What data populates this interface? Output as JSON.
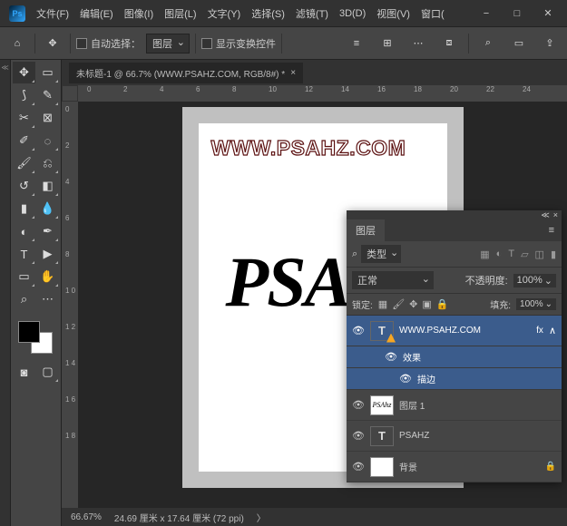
{
  "menu": {
    "file": "文件(F)",
    "edit": "编辑(E)",
    "image": "图像(I)",
    "layer": "图层(L)",
    "type": "文字(Y)",
    "select": "选择(S)",
    "filter": "滤镜(T)",
    "threeD": "3D(D)",
    "view": "视图(V)",
    "window": "窗口(",
    "win_min": "−",
    "win_max": "□",
    "win_close": "✕"
  },
  "opt": {
    "auto_select": "自动选择：",
    "target": "图层",
    "show_transform": "显示变换控件"
  },
  "doc": {
    "tab": "未标题-1 @ 66.7% (WWW.PSAHZ.COM, RGB/8#) *",
    "close": "×"
  },
  "ruler_h": {
    "r0": "0",
    "r2": "2",
    "r4": "4",
    "r6": "6",
    "r8": "8",
    "r10": "10",
    "r12": "12",
    "r14": "14",
    "r16": "16",
    "r18": "18",
    "r20": "20",
    "r22": "22",
    "r24": "24"
  },
  "ruler_v": {
    "r0": "0",
    "r2": "2",
    "r4": "4",
    "r6": "6",
    "r8": "8",
    "r10": "1\n0",
    "r12": "1\n2",
    "r14": "1\n4",
    "r16": "1\n6",
    "r18": "1\n8"
  },
  "canvas": {
    "watermark": "WWW.PSAHZ.COM",
    "script": "PSAH"
  },
  "status": {
    "zoom": "66.67%",
    "dims": "24.69 厘米 x 17.64 厘米 (72 ppi)",
    "caret": "〉"
  },
  "panel": {
    "tab": "图层",
    "menu": "≡",
    "search_icon": "⌕",
    "filter_type": "类型",
    "blend_mode": "正常",
    "opacity_label": "不透明度:",
    "opacity_val": "100%",
    "lock_label": "锁定:",
    "fill_label": "填充:",
    "fill_val": "100%",
    "layers": [
      {
        "name": "WWW.PSAHZ.COM",
        "fx": "fx",
        "chev": "∧"
      },
      {
        "fx_label": "效果"
      },
      {
        "stroke_label": "描边"
      },
      {
        "name": "图层 1"
      },
      {
        "name": "PSAHZ"
      },
      {
        "name": "背景"
      }
    ],
    "eye": "👁"
  }
}
